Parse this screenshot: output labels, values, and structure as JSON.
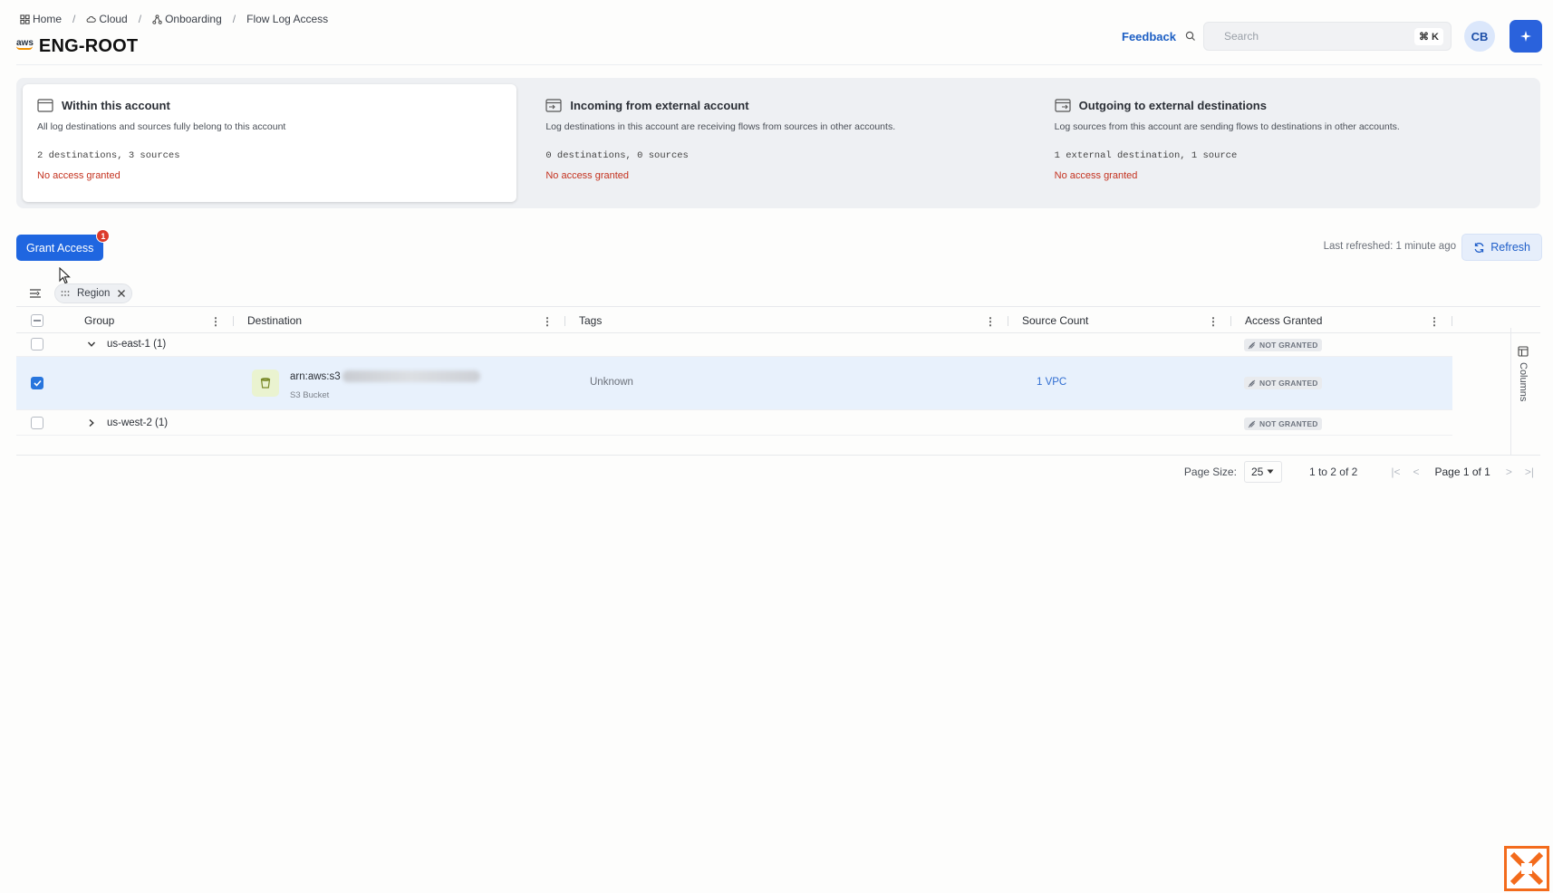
{
  "breadcrumb": {
    "home": "Home",
    "cloud": "Cloud",
    "onboarding": "Onboarding",
    "current": "Flow Log Access"
  },
  "header": {
    "provider_logo": "aws",
    "title": "ENG-ROOT",
    "feedback": "Feedback",
    "search_placeholder": "Search",
    "search_shortcut": "⌘ K",
    "avatar_initials": "CB"
  },
  "cards": [
    {
      "title": "Within this account",
      "description": "All log destinations and sources fully belong to this account",
      "counts": "2 destinations, 3 sources",
      "status": "No access granted"
    },
    {
      "title": "Incoming from external account",
      "description": "Log destinations in this account are receiving flows from sources in other accounts.",
      "counts": "0 destinations, 0 sources",
      "status": "No access granted"
    },
    {
      "title": "Outgoing to external destinations",
      "description": "Log sources from this account are sending flows to destinations in other accounts.",
      "counts": "1 external destination, 1 source",
      "status": "No access granted"
    }
  ],
  "actions": {
    "grant_access": "Grant Access",
    "grant_badge": "1",
    "last_refreshed": "Last refreshed: 1 minute ago",
    "refresh": "Refresh"
  },
  "grouping": {
    "chip_label": "Region"
  },
  "table": {
    "columns": [
      "Group",
      "Destination",
      "Tags",
      "Source Count",
      "Access Granted"
    ],
    "groups": [
      {
        "label": "us-east-1 (1)",
        "expanded": true,
        "access": "NOT GRANTED"
      },
      {
        "label": "us-west-2 (1)",
        "expanded": false,
        "access": "NOT GRANTED"
      }
    ],
    "row": {
      "arn_prefix": "arn:aws:s3",
      "type": "S3 Bucket",
      "tags": "Unknown",
      "source_count": "1 VPC",
      "access": "NOT GRANTED",
      "selected": true
    },
    "side_panel": "Columns"
  },
  "pagination": {
    "page_size_label": "Page Size:",
    "page_size": "25",
    "range": "1 to 2 of 2",
    "page_label": "Page 1 of 1"
  },
  "colors": {
    "primary": "#1f66e0",
    "danger": "#c4321f",
    "selected_row": "#e8f1fc"
  }
}
